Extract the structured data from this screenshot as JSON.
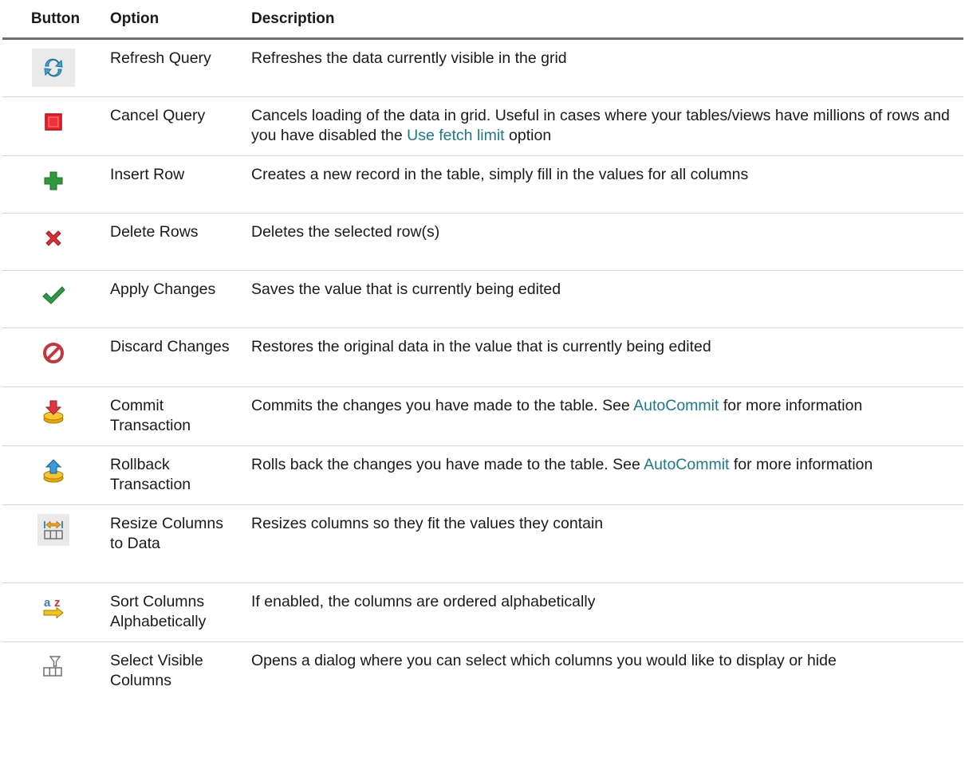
{
  "header": {
    "button": "Button",
    "option": "Option",
    "description": "Description"
  },
  "rows": [
    {
      "icon": "refresh-icon",
      "option": "Refresh Query",
      "description": "Refreshes the data currently visible in the grid"
    },
    {
      "icon": "stop-icon",
      "option": "Cancel Query",
      "description_before": "Cancels loading of the data in grid. Useful in cases where your tables/views have millions of rows and you have disabled the",
      "link": "Use fetch limit",
      "description_after": "option"
    },
    {
      "icon": "plus-icon",
      "option": "Insert Row",
      "description": "Creates a new record in the table, simply fill in the values for all columns"
    },
    {
      "icon": "delete-x-icon",
      "option": "Delete Rows",
      "description": "Deletes the selected row(s)"
    },
    {
      "icon": "checkmark-icon",
      "option": "Apply Changes",
      "description": "Saves the value that is currently being edited"
    },
    {
      "icon": "prohibited-icon",
      "option": "Discard Changes",
      "description": "Restores the original data in the value that is currently being edited"
    },
    {
      "icon": "commit-down-arrow-icon",
      "option": "Commit Transaction",
      "description_before": "Commits the changes you have made to the table. See",
      "link": "AutoCommit",
      "description_after": "for more information"
    },
    {
      "icon": "rollback-up-arrow-icon",
      "option": "Rollback Transaction",
      "description_before": "Rolls back the changes you have made to the table. See",
      "link": "AutoCommit",
      "description_after": "for more information"
    },
    {
      "icon": "resize-columns-icon",
      "option": "Resize Columns to Data",
      "description": "Resizes columns so they fit the values they contain"
    },
    {
      "icon": "sort-az-icon",
      "option": "Sort Columns Alphabetically",
      "description": "If enabled, the columns are ordered alphabetically"
    },
    {
      "icon": "filter-columns-icon",
      "option": "Select Visible Columns",
      "description": "Opens a dialog where you can select which columns you would like to display or hide"
    }
  ],
  "colors": {
    "link": "#1a7a8a",
    "header_rule": "#6e6e6e",
    "row_rule": "#d6d6d6"
  }
}
